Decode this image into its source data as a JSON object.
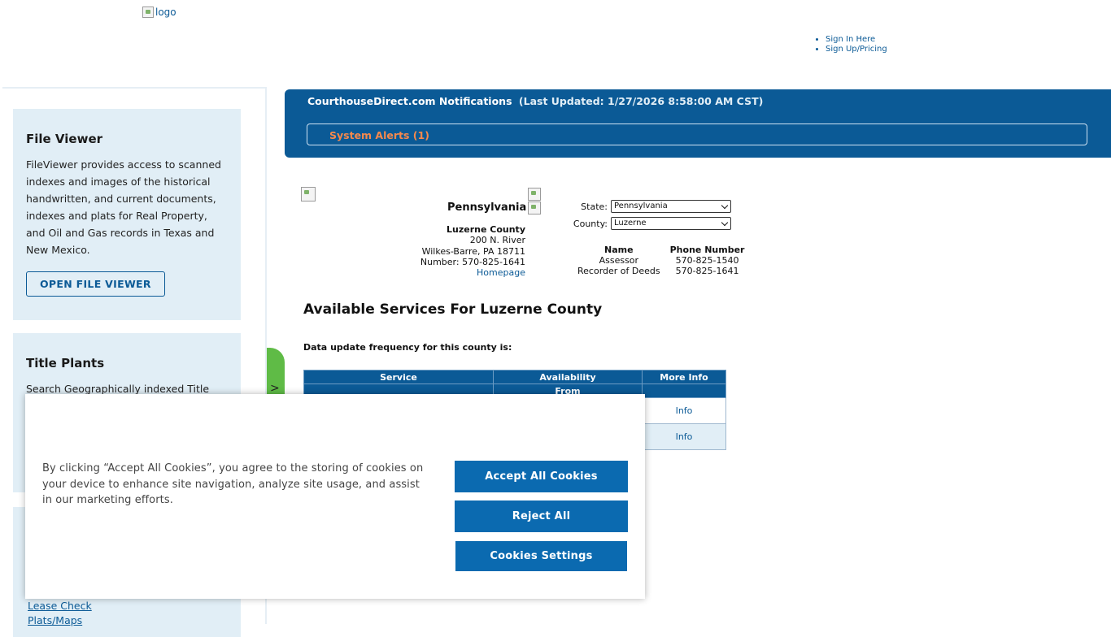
{
  "header": {
    "logo_alt": "logo",
    "auth_links": [
      "Sign In Here",
      "Sign Up/Pricing"
    ]
  },
  "sidebar": {
    "file_viewer": {
      "title": "File Viewer",
      "text": "FileViewer provides access to scanned indexes and images of the historical handwritten, and current documents, indexes and plats for Real Property, and Oil and Gas records in Texas and New Mexico.",
      "button": "OPEN FILE VIEWER"
    },
    "title_plants": {
      "title": "Title Plants",
      "text": "Search Geographically indexed Title"
    },
    "links": [
      "Lease Check",
      "Plats/Maps"
    ],
    "expand_tab_glyph": ">"
  },
  "notifications": {
    "title": "CourthouseDirect.com Notifications",
    "last_updated": "(Last Updated: 1/27/2026 8:58:00 AM CST)",
    "alerts_label": "System Alerts (1)"
  },
  "county": {
    "state_name": "Pennsylvania",
    "county_name": "Luzerne County",
    "address_line1": "200 N. River",
    "address_line2": "Wilkes-Barre, PA 18711",
    "number": "Number: 570-825-1641",
    "homepage_link": "Homepage"
  },
  "selectors": {
    "state_label": "State:",
    "state_value": "Pennsylvania",
    "county_label": "County:",
    "county_value": "Luzerne"
  },
  "contacts": {
    "headers": [
      "Name",
      "Phone Number"
    ],
    "rows": [
      [
        "Assessor",
        "570-825-1540"
      ],
      [
        "Recorder of Deeds",
        "570-825-1641"
      ]
    ]
  },
  "services": {
    "title": "Available Services For Luzerne County",
    "frequency_label": "Data update frequency for this county is:",
    "table_headers": [
      "Service",
      "Availability",
      "More Info"
    ],
    "availability_subheader": "From",
    "rows": [
      {
        "info": "Info"
      },
      {
        "info": "Info"
      }
    ]
  },
  "cookie_banner": {
    "text": "By clicking “Accept All Cookies”, you agree to the storing of cookies on your device to enhance site navigation, analyze site usage, and assist in our marketing efforts.",
    "accept_label": "Accept All Cookies",
    "reject_label": "Reject All",
    "settings_label": "Cookies Settings"
  },
  "colors": {
    "brand_blue": "#0b5a96",
    "card_bg": "#e1eef6",
    "alert_orange": "#f7894c",
    "button_blue": "#0b6ab0",
    "tab_green": "#5fbb46"
  }
}
